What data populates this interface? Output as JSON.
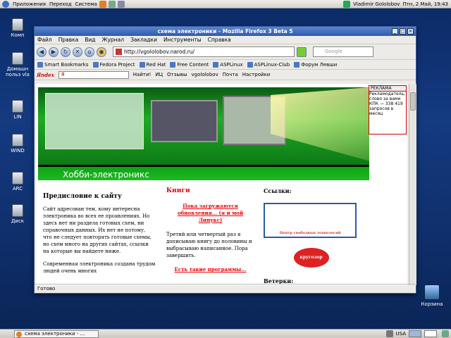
{
  "panel": {
    "menus": [
      "Приложения",
      "Переход",
      "Система"
    ],
    "user": "Vladimir Gololobov",
    "datetime": "Птн, 2 Май, 19:43"
  },
  "desktop": {
    "icons": [
      "Комп",
      "Домашн польз vla",
      "LIN",
      "WIND",
      "ARC",
      "Диск"
    ],
    "trash": "Корзина"
  },
  "window": {
    "title": "схема электроники - Mozilla Firefox 3 Beta 5",
    "menu": [
      "Файл",
      "Правка",
      "Вид",
      "Журнал",
      "Закладки",
      "Инструменты",
      "Справка"
    ],
    "url": "http://vgololobov.narod.ru/",
    "search_placeholder": "Google",
    "bookmarks": [
      "Smart Bookmarks",
      "Fedora Project",
      "Red Hat",
      "Free Content",
      "ASPLinux",
      "ASPLinux-Club",
      "Форум Левши"
    ],
    "yandex": {
      "logo": "Яndex",
      "input": "Я",
      "find": "Найти!",
      "ic": "ИЦ",
      "reviews": "Отзывы",
      "user": "vgololobov",
      "mail": "Почта",
      "settings": "Настройки"
    },
    "status": "Готово"
  },
  "page": {
    "hobby": "Хобби-электроникс",
    "foreword_title": "Предисловие к сайту",
    "p1": "Сайт адресован тем, кому интересна электроника во всех ее проявлениях. Но здесь нет ни раздела готовых схем, ни справочных данных. Их нет не потому, что не следует повторять готовые схемы, но схем много на других сайтах, ссылки на которые вы найдете ниже.",
    "p2": "Современная электроника создана трудом людей очень многих",
    "books": "Книги",
    "books_link1": "Пока загружаются обновления... (я и мой Линукс)",
    "books_text": "Третий или четвертый раз я дописываю книгу до половины и выбрасываю написанное. Пора завершить.",
    "books_link2": "Есть такие программы...",
    "links": "Ссылки:",
    "cst": "Центр свободных технологий",
    "kru": "кругозор",
    "vetor": "Ветерки:",
    "ad": {
      "head": "РЕКЛАМА",
      "line1": "Рекламодатель, слово за вами",
      "line2": "КПК — 338 419 запросов в месяц"
    }
  },
  "taskbar": {
    "task": "схема электроники - ...",
    "lang": "USA"
  }
}
